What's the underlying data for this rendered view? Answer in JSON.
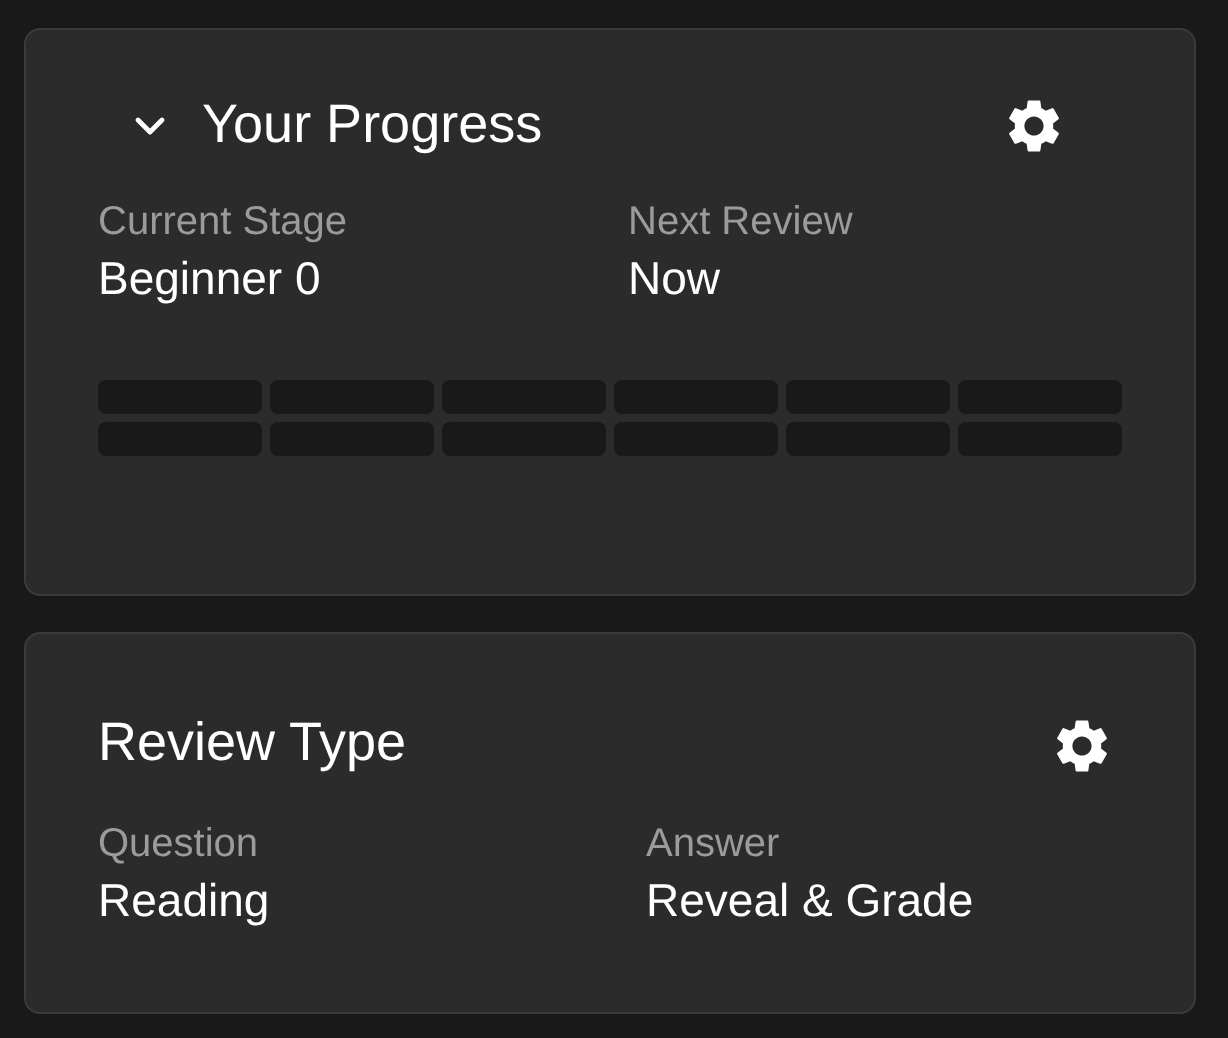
{
  "progress": {
    "title": "Your Progress",
    "expanded": true,
    "stats": [
      {
        "label": "Current Stage",
        "value": "Beginner 0"
      },
      {
        "label": "Next Review",
        "value": "Now"
      }
    ]
  },
  "review_type": {
    "title": "Review Type",
    "stats": [
      {
        "label": "Question",
        "value": "Reading"
      },
      {
        "label": "Answer",
        "value": "Reveal & Grade"
      }
    ]
  }
}
